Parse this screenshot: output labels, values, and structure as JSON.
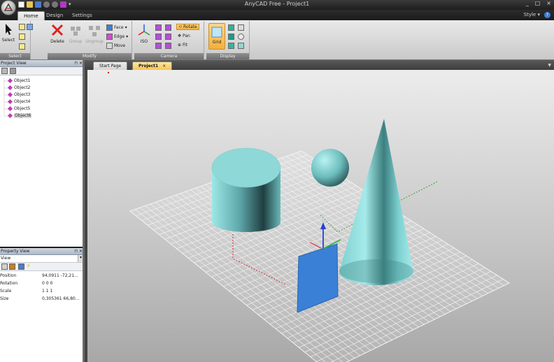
{
  "window": {
    "title": "AnyCAD Free - Project1",
    "controls": [
      "_",
      "□",
      "×"
    ]
  },
  "ribbon_tabs": [
    {
      "label": "Home",
      "active": true
    },
    {
      "label": "Design",
      "active": false
    },
    {
      "label": "Settings",
      "active": false
    }
  ],
  "style_menu": "Style",
  "help": "?",
  "groups": {
    "select": {
      "label": "Select",
      "select_button": "Select"
    },
    "modify": {
      "label": "Modify",
      "delete": "Delete",
      "group": "Group",
      "ungroup": "Ungroup",
      "face": "Face",
      "edge": "Edge",
      "move": "Move"
    },
    "camera": {
      "label": "Camera",
      "iso": "ISO",
      "rotate": "Rotate",
      "pan": "Pan",
      "fit": "Fit"
    },
    "display": {
      "label": "Display",
      "grid": "Grid"
    }
  },
  "project_view": {
    "title": "Project View",
    "objects": [
      "Object1",
      "Object2",
      "Object3",
      "Object4",
      "Object5",
      "Object6"
    ],
    "selected_index": 5
  },
  "property_view": {
    "title": "Property View",
    "dropdown": "View",
    "rows": [
      {
        "key": "Position",
        "value": "94,0911 -72,21..."
      },
      {
        "key": "Rotation",
        "value": "0 0 0"
      },
      {
        "key": "Scale",
        "value": "1 1 1"
      },
      {
        "key": "Size",
        "value": "0,305361 66,80..."
      }
    ]
  },
  "document_tabs": [
    {
      "label": "Start Page",
      "active": false
    },
    {
      "label": "Project1",
      "active": true,
      "close": "×"
    }
  ],
  "colors": {
    "model": "#8ee3e3",
    "plane": "#3a80d6",
    "ribbon_highlight": "#f3b03c"
  }
}
